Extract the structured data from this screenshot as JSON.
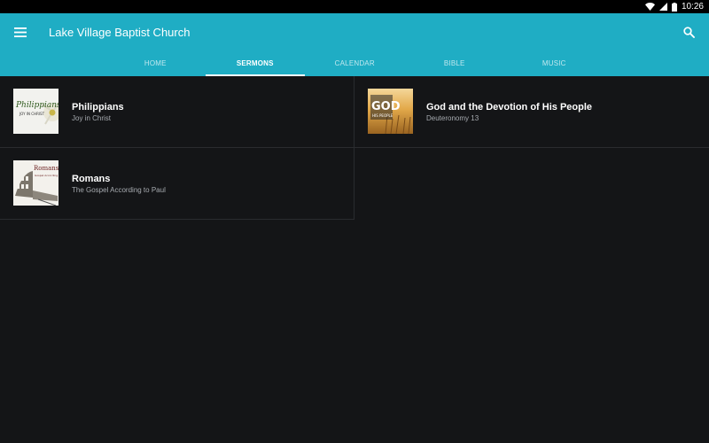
{
  "status_bar": {
    "time": "10:26",
    "icons": [
      "wifi-icon",
      "signal-icon",
      "battery-icon"
    ]
  },
  "app_bar": {
    "title": "Lake Village Baptist Church",
    "menu_icon": "hamburger-menu-icon",
    "search_icon": "search-icon"
  },
  "tabs": [
    {
      "label": "HOME",
      "active": false
    },
    {
      "label": "SERMONS",
      "active": true
    },
    {
      "label": "CALENDAR",
      "active": false
    },
    {
      "label": "BIBLE",
      "active": false
    },
    {
      "label": "MUSIC",
      "active": false
    }
  ],
  "sermons": [
    {
      "title": "Philippians",
      "subtitle": "Joy in Christ",
      "thumb_text": "Philippians",
      "thumb_sub": "JOY IN CHRIST"
    },
    {
      "title": "God and the Devotion of His People",
      "subtitle": "Deuteronomy 13",
      "thumb_text": "GOD",
      "thumb_sub": "HIS PEOPLE"
    },
    {
      "title": "Romans",
      "subtitle": "The Gospel According to Paul",
      "thumb_text": "Romans",
      "thumb_sub": "Gospel According"
    }
  ],
  "colors": {
    "app_bar": "#1fadc4",
    "background": "#141517",
    "divider": "#2a2c2f",
    "subtitle": "#a7abb0"
  }
}
